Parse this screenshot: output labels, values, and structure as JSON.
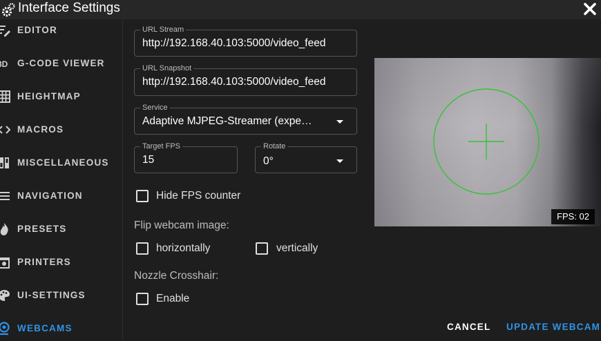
{
  "window": {
    "title": "Interface Settings",
    "close_icon": "close-icon"
  },
  "sidebar": {
    "items": [
      {
        "label": "EDITOR",
        "icon": "file-edit-icon"
      },
      {
        "label": "G-CODE VIEWER",
        "icon": "video-3d-icon"
      },
      {
        "label": "HEIGHTMAP",
        "icon": "grid-icon"
      },
      {
        "label": "MACROS",
        "icon": "code-brackets-icon"
      },
      {
        "label": "MISCELLANEOUS",
        "icon": "dip-switch-icon"
      },
      {
        "label": "NAVIGATION",
        "icon": "menu-icon"
      },
      {
        "label": "PRESETS",
        "icon": "fire-icon"
      },
      {
        "label": "PRINTERS",
        "icon": "printer-3d-icon"
      },
      {
        "label": "UI-SETTINGS",
        "icon": "palette-icon"
      },
      {
        "label": "WEBCAMS",
        "icon": "webcam-icon",
        "active": true
      }
    ]
  },
  "form": {
    "url_stream": {
      "label": "URL Stream",
      "value": "http://192.168.40.103:5000/video_feed"
    },
    "url_snapshot": {
      "label": "URL Snapshot",
      "value": "http://192.168.40.103:5000/video_feed"
    },
    "service": {
      "label": "Service",
      "value": "Adaptive MJPEG-Streamer (expe…"
    },
    "target_fps": {
      "label": "Target FPS",
      "value": "15"
    },
    "rotate": {
      "label": "Rotate",
      "value": "0°"
    },
    "hide_fps": {
      "label": "Hide FPS counter",
      "checked": false
    },
    "flip_label": "Flip webcam image:",
    "flip_horizontal": {
      "label": "horizontally",
      "checked": false
    },
    "flip_vertical": {
      "label": "vertically",
      "checked": false
    },
    "crosshair_label": "Nozzle Crosshair:",
    "crosshair_enable": {
      "label": "Enable",
      "checked": false
    }
  },
  "preview": {
    "fps_text": "FPS: 02",
    "crosshair_color": "#36c236"
  },
  "actions": {
    "cancel": "CANCEL",
    "update": "UPDATE WEBCAM"
  },
  "colors": {
    "accent": "#2f93e8",
    "background": "#1e1e1e"
  }
}
